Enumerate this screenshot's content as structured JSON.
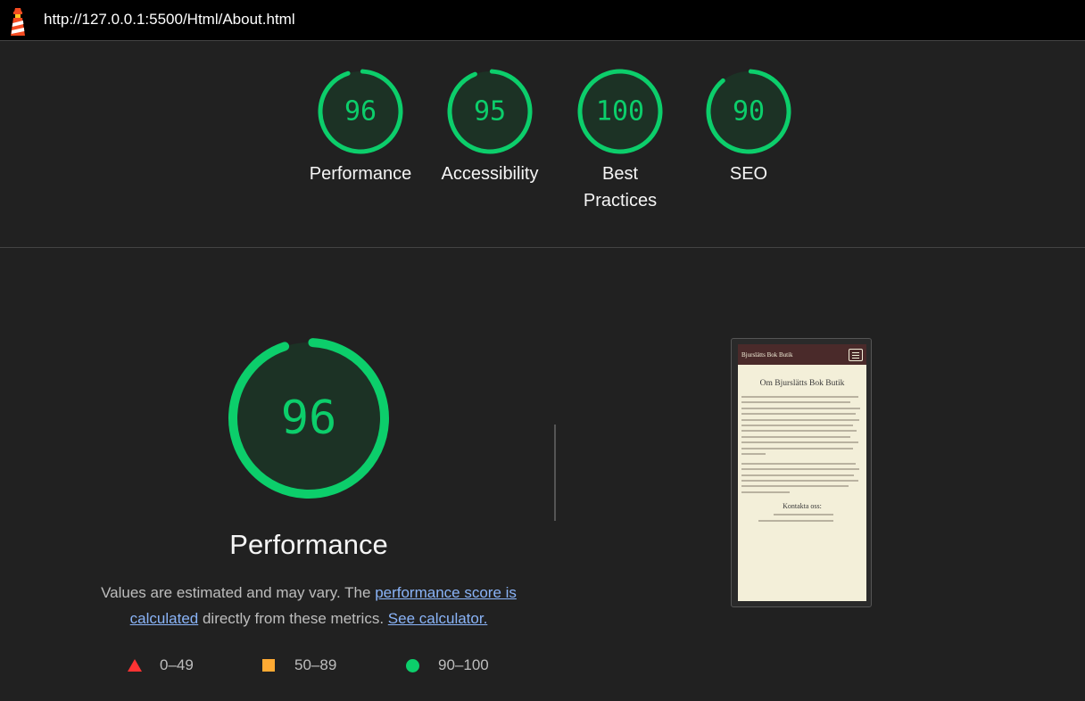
{
  "header": {
    "url": "http://127.0.0.1:5500/Html/About.html"
  },
  "gauges": [
    {
      "score": 96,
      "label": "Performance"
    },
    {
      "score": 95,
      "label": "Accessibility"
    },
    {
      "score": 100,
      "label": "Best Practices"
    },
    {
      "score": 90,
      "label": "SEO"
    }
  ],
  "performance": {
    "score": 96,
    "title": "Performance",
    "desc_prefix": "Values are estimated and may vary. The ",
    "desc_link": "performance score is calculated",
    "desc_middle": " directly from these metrics. ",
    "desc_calc_link": "See calculator."
  },
  "legend": [
    {
      "range": "0–49",
      "shape": "triangle",
      "color": "#ff3333"
    },
    {
      "range": "50–89",
      "shape": "square",
      "color": "#ffaa33"
    },
    {
      "range": "90–100",
      "shape": "circle",
      "color": "#0cce6b"
    }
  ],
  "thumbnail": {
    "brand": "Bjurslätts Bok Butik",
    "heading": "Om Bjurslätts Bok Butik",
    "contact_heading": "Kontakta oss:"
  },
  "colors": {
    "pass": "#0cce6b",
    "pass_bg": "#1c3225",
    "background": "#212121"
  }
}
